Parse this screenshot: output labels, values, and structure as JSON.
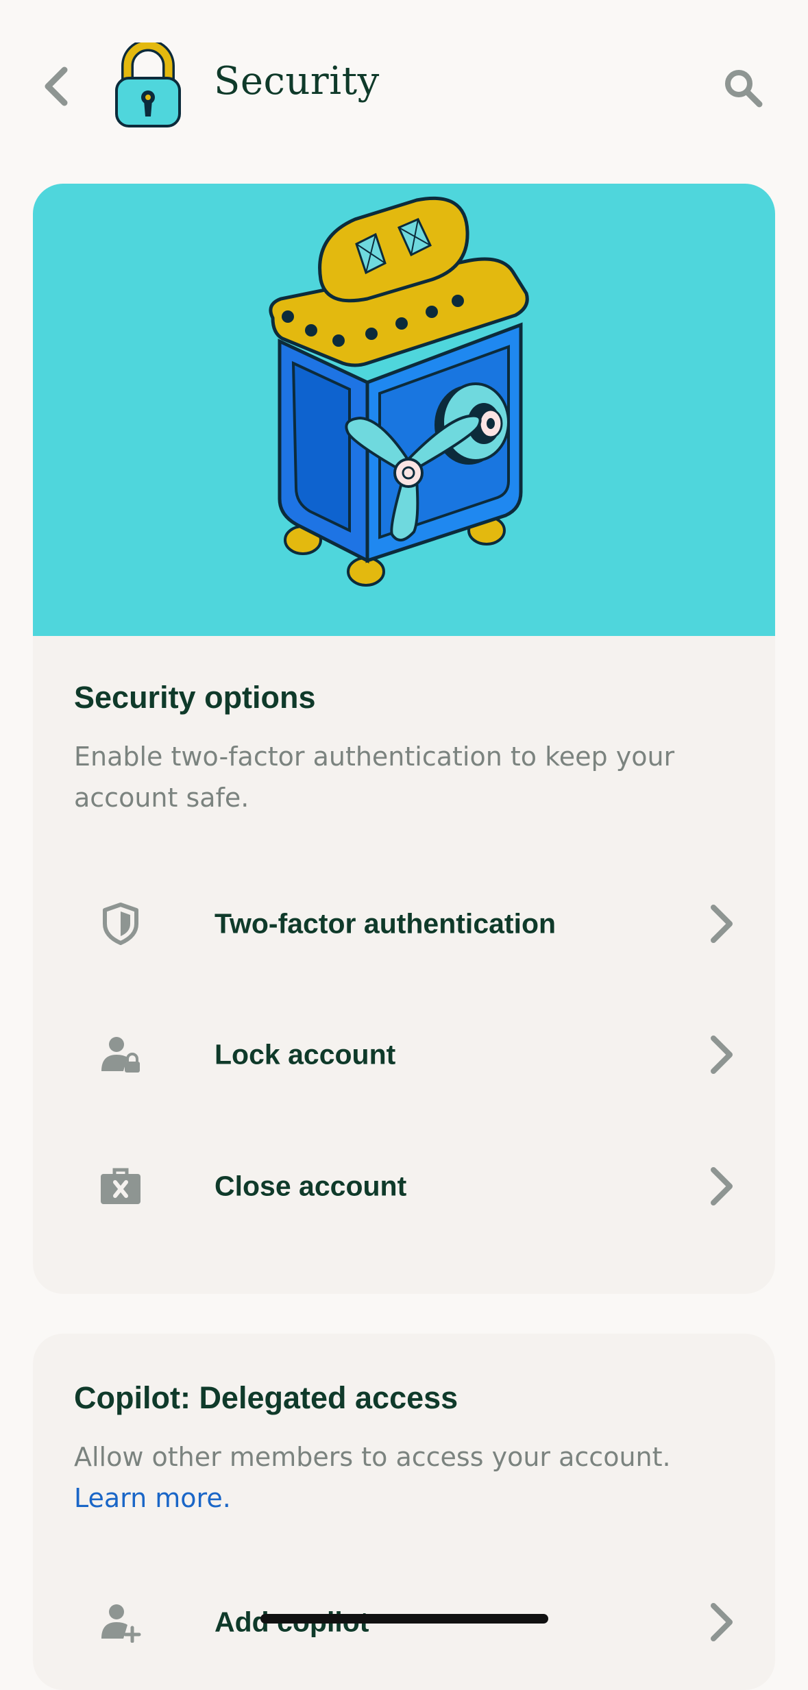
{
  "header": {
    "title": "Security",
    "back_icon": "chevron-left-icon",
    "logo_icon": "padlock-icon",
    "search_icon": "search-icon"
  },
  "security_options": {
    "hero_image": "safe-illustration",
    "title": "Security options",
    "description": "Enable two-factor authentication to keep your account safe.",
    "items": [
      {
        "label": "Two-factor authentication",
        "icon": "shield-icon"
      },
      {
        "label": "Lock account",
        "icon": "user-lock-icon"
      },
      {
        "label": "Close account",
        "icon": "briefcase-x-icon"
      }
    ]
  },
  "copilot": {
    "title": "Copilot: Delegated access",
    "description": "Allow other members to access your account.",
    "learn_more": "Learn more.",
    "items": [
      {
        "label": "Add copilot",
        "icon": "user-add-icon"
      }
    ]
  },
  "colors": {
    "background": "#faf8f6",
    "card": "#f5f2ef",
    "hero": "#4fd6dc",
    "title_text": "#0f3a2a",
    "body_text": "#7b837f",
    "link": "#1a66c7",
    "icon_gray": "#8e9592"
  }
}
